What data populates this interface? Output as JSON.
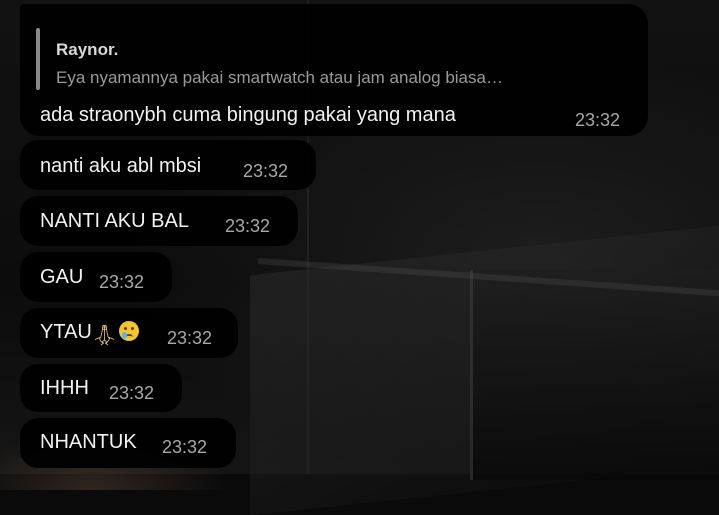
{
  "reply_message": {
    "quote": {
      "author": "Raynor.",
      "text": "Eya nyamannya pakai smartwatch atau jam analog biasa…"
    },
    "text": "ada straonybh cuma bingung pakai yang mana",
    "time": "23:32"
  },
  "messages": [
    {
      "text": "nanti aku abl mbsi",
      "time": "23:32"
    },
    {
      "text": "NANTI AKU BAL",
      "time": "23:32"
    },
    {
      "text": "GAU",
      "time": "23:32"
    },
    {
      "text": "YTAU",
      "emoji": [
        "folded-hands-emoji",
        "crying-face-emoji"
      ],
      "time": "23:32"
    },
    {
      "text": "IHHH",
      "time": "23:32"
    },
    {
      "text": "NHANTUK",
      "time": "23:32"
    }
  ]
}
